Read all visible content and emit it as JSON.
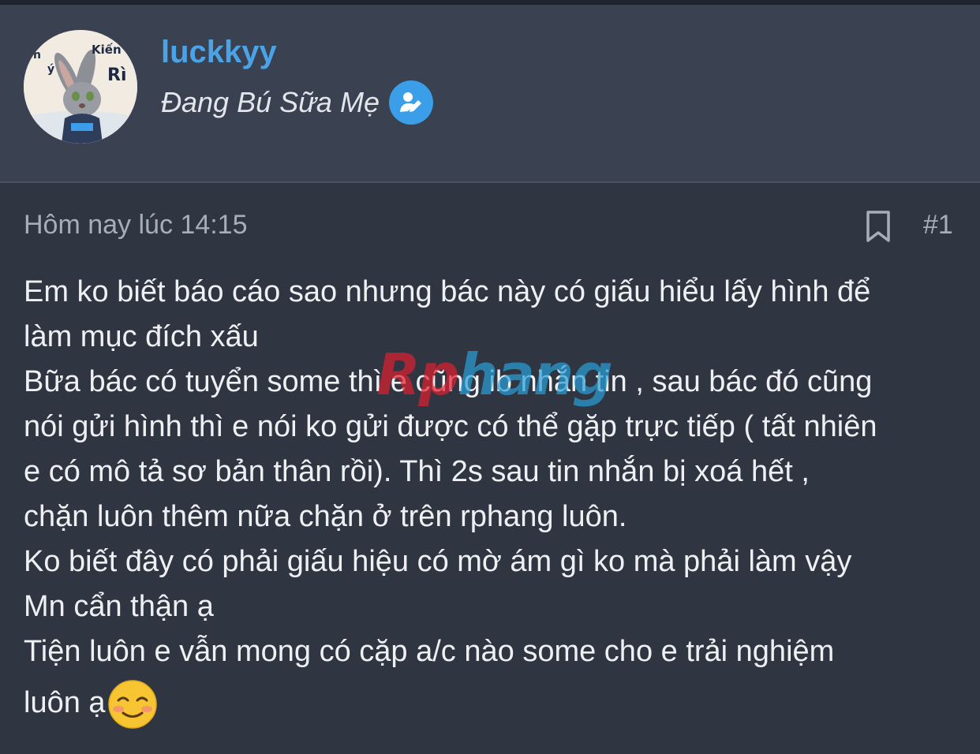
{
  "user": {
    "username": "luckkyy",
    "status": "Đang Bú Sữa Mẹ",
    "avatar_text_top": "Kiến",
    "avatar_text_side": "Rì",
    "avatar_text_left": "n",
    "avatar_text_left2": "ý"
  },
  "post": {
    "timestamp": "Hôm nay lúc 14:15",
    "number": "#1",
    "lines": [
      "Em ko biết báo cáo sao nhưng bác này có giấu hiểu lấy hình để",
      "làm mục đích xấu",
      "Bữa bác có tuyển some thì e cũng ib nhắn tin , sau bác đó cũng",
      "nói gửi hình thì e nói ko gửi được có thể gặp trực tiếp ( tất nhiên",
      "e có mô tả sơ bản thân rồi). Thì 2s sau tin nhắn bị xoá hết ,",
      "chặn luôn thêm nữa chặn ở trên rphang luôn.",
      "Ko biết đây có phải giấu hiệu có mờ ám gì ko mà phải làm vậy",
      "Mn cẩn thận ạ",
      "Tiện luôn e vẫn mong có cặp a/c nào some cho e trải nghiệm",
      "luôn ạ"
    ]
  },
  "watermark": {
    "text_red": "Rp",
    "text_blue": "hang"
  },
  "icons": {
    "edit": "edit-pen-icon",
    "bookmark": "bookmark-icon",
    "emoji": "smiling-face-emoji"
  },
  "colors": {
    "username": "#4aa3e6",
    "edit_button": "#3b9ee9",
    "watermark_red": "#e02030",
    "watermark_blue": "#2a9fd8"
  }
}
